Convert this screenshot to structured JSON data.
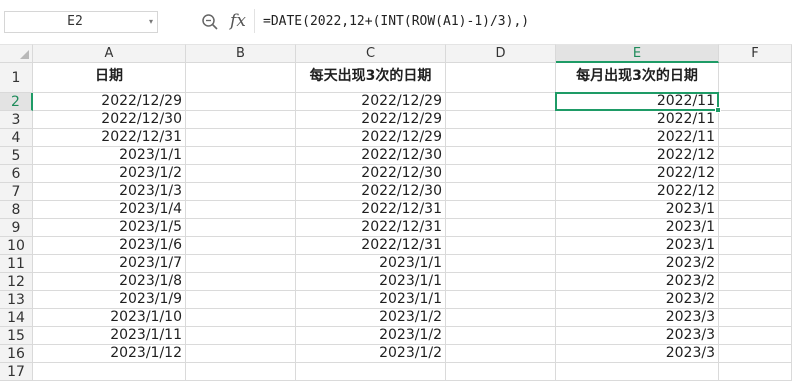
{
  "formula_bar": {
    "name_box": "E2",
    "name_box_arrow": "▾",
    "fx_label": "fx",
    "formula": "=DATE(2022,12+(INT(ROW(A1)-1)/3),)"
  },
  "columns": [
    "A",
    "B",
    "C",
    "D",
    "E",
    "F"
  ],
  "selected_cell": "E2",
  "rows": [
    {
      "n": "1",
      "a": "日期",
      "b": "",
      "c": "每天出现3次的日期",
      "d": "",
      "e": "每月出现3次的日期",
      "f": ""
    },
    {
      "n": "2",
      "a": "2022/12/29",
      "b": "",
      "c": "2022/12/29",
      "d": "",
      "e": "2022/11",
      "f": ""
    },
    {
      "n": "3",
      "a": "2022/12/30",
      "b": "",
      "c": "2022/12/29",
      "d": "",
      "e": "2022/11",
      "f": ""
    },
    {
      "n": "4",
      "a": "2022/12/31",
      "b": "",
      "c": "2022/12/29",
      "d": "",
      "e": "2022/11",
      "f": ""
    },
    {
      "n": "5",
      "a": "2023/1/1",
      "b": "",
      "c": "2022/12/30",
      "d": "",
      "e": "2022/12",
      "f": ""
    },
    {
      "n": "6",
      "a": "2023/1/2",
      "b": "",
      "c": "2022/12/30",
      "d": "",
      "e": "2022/12",
      "f": ""
    },
    {
      "n": "7",
      "a": "2023/1/3",
      "b": "",
      "c": "2022/12/30",
      "d": "",
      "e": "2022/12",
      "f": ""
    },
    {
      "n": "8",
      "a": "2023/1/4",
      "b": "",
      "c": "2022/12/31",
      "d": "",
      "e": "2023/1",
      "f": ""
    },
    {
      "n": "9",
      "a": "2023/1/5",
      "b": "",
      "c": "2022/12/31",
      "d": "",
      "e": "2023/1",
      "f": ""
    },
    {
      "n": "10",
      "a": "2023/1/6",
      "b": "",
      "c": "2022/12/31",
      "d": "",
      "e": "2023/1",
      "f": ""
    },
    {
      "n": "11",
      "a": "2023/1/7",
      "b": "",
      "c": "2023/1/1",
      "d": "",
      "e": "2023/2",
      "f": ""
    },
    {
      "n": "12",
      "a": "2023/1/8",
      "b": "",
      "c": "2023/1/1",
      "d": "",
      "e": "2023/2",
      "f": ""
    },
    {
      "n": "13",
      "a": "2023/1/9",
      "b": "",
      "c": "2023/1/1",
      "d": "",
      "e": "2023/2",
      "f": ""
    },
    {
      "n": "14",
      "a": "2023/1/10",
      "b": "",
      "c": "2023/1/2",
      "d": "",
      "e": "2023/3",
      "f": ""
    },
    {
      "n": "15",
      "a": "2023/1/11",
      "b": "",
      "c": "2023/1/2",
      "d": "",
      "e": "2023/3",
      "f": ""
    },
    {
      "n": "16",
      "a": "2023/1/12",
      "b": "",
      "c": "2023/1/2",
      "d": "",
      "e": "2023/3",
      "f": ""
    },
    {
      "n": "17",
      "a": "",
      "b": "",
      "c": "",
      "d": "",
      "e": "",
      "f": ""
    }
  ],
  "colors": {
    "accent": "#1e9b66",
    "header_bg": "#f3f3f3",
    "gridline": "#dadada"
  }
}
